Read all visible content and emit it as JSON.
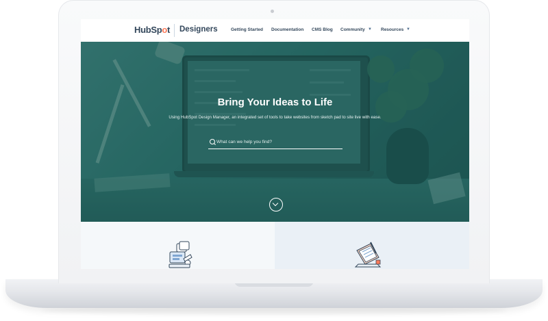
{
  "brand": {
    "logo_pre": "HubSp",
    "logo_mid": "o",
    "logo_post": "t",
    "section": "Designers"
  },
  "nav": {
    "items": [
      {
        "label": "Getting Started"
      },
      {
        "label": "Documentation"
      },
      {
        "label": "CMS Blog"
      },
      {
        "label": "Community",
        "has_dropdown": true
      },
      {
        "label": "Resources",
        "has_dropdown": true
      }
    ]
  },
  "hero": {
    "title": "Bring Your Ideas to Life",
    "subtitle": "Using HubSpot Design Manager, an integrated set of tools to take websites from sketch pad to site live with ease.",
    "search_placeholder": "What can we help you find?",
    "scroll_icon": "chevron-down-icon"
  },
  "cards": [
    {
      "icon": "design-tools-icon"
    },
    {
      "icon": "notebook-pen-icon"
    }
  ],
  "colors": {
    "brand_text": "#33475b",
    "brand_accent": "#ff7a59",
    "hero_overlay": "#2d6e69"
  }
}
